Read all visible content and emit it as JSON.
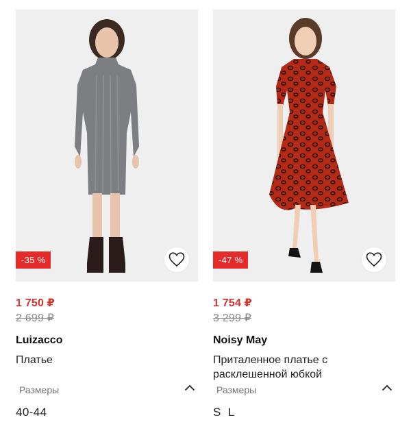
{
  "products": [
    {
      "discount": "-35 %",
      "price_new": "1 750 ₽",
      "price_old": "2 699 ₽",
      "brand": "Luizacco",
      "title": "Платье",
      "sizes_label": "Размеры",
      "sizes": "40-44",
      "dress_color": "#7d7e82",
      "icons": [
        "heart-icon",
        "chevron-up-icon"
      ]
    },
    {
      "discount": "-47 %",
      "price_new": "1 754 ₽",
      "price_old": "3 299 ₽",
      "brand": "Noisy May",
      "title": "Приталенное платье с расклешенной юбкой",
      "sizes_label": "Размеры",
      "sizes": "S  L",
      "dress_color": "#b42a17",
      "icons": [
        "heart-icon",
        "chevron-up-icon"
      ]
    }
  ],
  "colors": {
    "sale_badge": "#e62b2b",
    "sale_price": "#d8332f",
    "old_price": "#8a8a8a"
  }
}
